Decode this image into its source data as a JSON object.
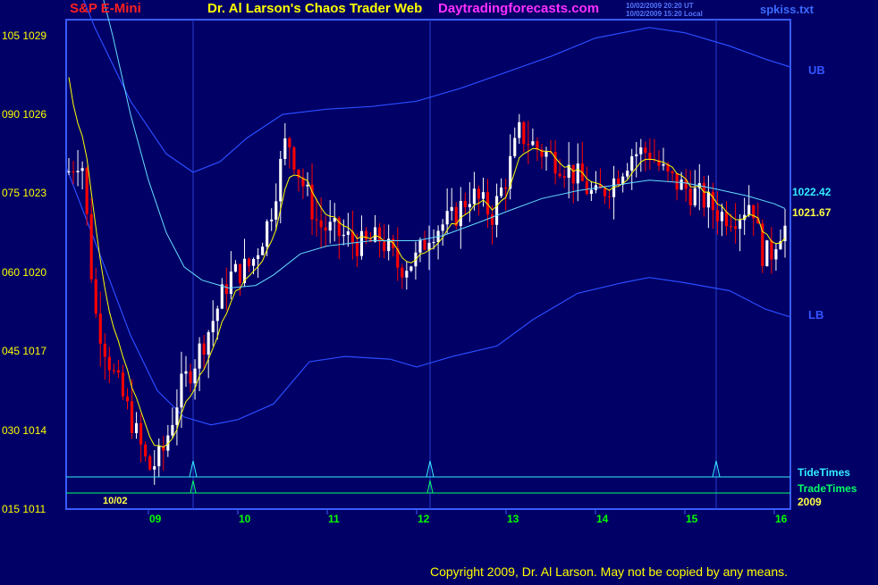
{
  "header": {
    "instrument": "S&P E-Mini",
    "title": "Dr. Al Larson's Chaos Trader Web",
    "site": "Daytradingforecasts.com",
    "stamp_line1": "10/02/2009 20:20 UT",
    "stamp_line2": "10/02/2009 15:20 Local",
    "filename": "spkiss.txt"
  },
  "footer": {
    "copyright": "Copyright 2009, Dr. Al Larson. May not be copied by any means."
  },
  "labels": {
    "upper_band": "UB",
    "lower_band": "LB",
    "tide_times": "TideTimes",
    "trade_times": "TradeTimes",
    "year": "2009",
    "start_date": "10/02",
    "last_cyan": "1022.42",
    "last_yellow": "1021.67"
  },
  "colors": {
    "background": "#000066",
    "frame": "#3b5bff",
    "up_candle": "#ffffff",
    "down_candle": "#ff0000",
    "fast_ma": "#ffff00",
    "slow_ma": "#66ddff",
    "bands": "#2a4cff",
    "tide": "#33eeff",
    "trade": "#00ff66"
  },
  "chart_data": {
    "type": "candlestick",
    "title": "S&P E-Mini",
    "y_ticks": [
      {
        "code": "105",
        "value": "1029"
      },
      {
        "code": "090",
        "value": "1026"
      },
      {
        "code": "075",
        "value": "1023"
      },
      {
        "code": "060",
        "value": "1020"
      },
      {
        "code": "045",
        "value": "1017"
      },
      {
        "code": "030",
        "value": "1014"
      },
      {
        "code": "015",
        "value": "1011"
      }
    ],
    "ylim": [
      1011,
      1029.6
    ],
    "x_ticks": [
      "09",
      "10",
      "11",
      "12",
      "13",
      "14",
      "15",
      "16"
    ],
    "x_tick_pos": [
      9,
      10,
      11,
      12,
      13,
      14,
      15,
      16
    ],
    "xlim": [
      8.08,
      16.18
    ],
    "tide_times": [
      9.5,
      12.15,
      15.35
    ],
    "trade_times": [
      9.5,
      12.15
    ],
    "upper_band": [
      [
        8.08,
        1032
      ],
      [
        8.4,
        1029.3
      ],
      [
        8.8,
        1026.5
      ],
      [
        9.2,
        1024.5
      ],
      [
        9.5,
        1023.8
      ],
      [
        9.8,
        1024.2
      ],
      [
        10.1,
        1025.1
      ],
      [
        10.5,
        1026
      ],
      [
        11,
        1026.2
      ],
      [
        11.5,
        1026.3
      ],
      [
        12,
        1026.5
      ],
      [
        12.5,
        1027
      ],
      [
        13,
        1027.6
      ],
      [
        13.5,
        1028.2
      ],
      [
        14,
        1028.9
      ],
      [
        14.6,
        1029.3
      ],
      [
        15,
        1029.1
      ],
      [
        15.5,
        1028.6
      ],
      [
        15.9,
        1028.1
      ],
      [
        16.18,
        1027.8
      ]
    ],
    "lower_band": [
      [
        8.08,
        1024
      ],
      [
        8.5,
        1020.3
      ],
      [
        8.8,
        1017.6
      ],
      [
        9.1,
        1015.5
      ],
      [
        9.4,
        1014.5
      ],
      [
        9.7,
        1014.2
      ],
      [
        10,
        1014.4
      ],
      [
        10.4,
        1015
      ],
      [
        10.8,
        1016.6
      ],
      [
        11.2,
        1016.8
      ],
      [
        11.7,
        1016.7
      ],
      [
        12,
        1016.4
      ],
      [
        12.4,
        1016.8
      ],
      [
        12.9,
        1017.2
      ],
      [
        13.3,
        1018.2
      ],
      [
        13.8,
        1019.2
      ],
      [
        14.3,
        1019.6
      ],
      [
        14.6,
        1019.8
      ],
      [
        15,
        1019.6
      ],
      [
        15.5,
        1019.3
      ],
      [
        15.9,
        1018.6
      ],
      [
        16.18,
        1018.3
      ]
    ],
    "slow_ma": [
      [
        8.45,
        1031
      ],
      [
        8.6,
        1029
      ],
      [
        8.8,
        1026
      ],
      [
        9,
        1023.5
      ],
      [
        9.2,
        1021.5
      ],
      [
        9.4,
        1020.2
      ],
      [
        9.6,
        1019.7
      ],
      [
        9.9,
        1019.4
      ],
      [
        10.2,
        1019.5
      ],
      [
        10.4,
        1019.9
      ],
      [
        10.7,
        1020.7
      ],
      [
        11,
        1021
      ],
      [
        11.5,
        1021.2
      ],
      [
        12,
        1021.2
      ],
      [
        12.3,
        1021.4
      ],
      [
        12.7,
        1021.9
      ],
      [
        13,
        1022.3
      ],
      [
        13.4,
        1022.8
      ],
      [
        13.8,
        1023.1
      ],
      [
        14.2,
        1023.3
      ],
      [
        14.6,
        1023.5
      ],
      [
        15,
        1023.4
      ],
      [
        15.3,
        1023.2
      ],
      [
        15.7,
        1022.9
      ],
      [
        16.0,
        1022.6
      ],
      [
        16.12,
        1022.42
      ]
    ]
  }
}
